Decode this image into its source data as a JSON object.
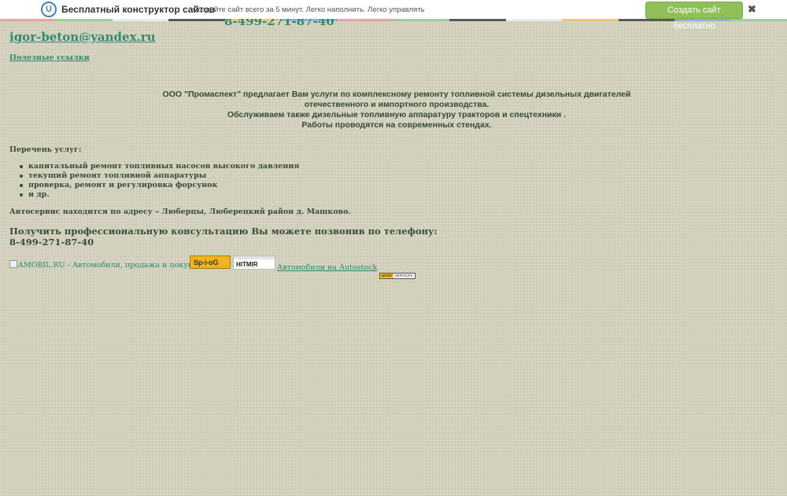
{
  "promo_bar": {
    "logo_letter": "U",
    "title": "Бесплатный конструктор сайтов",
    "subtitle": "Создайте сайт всего за 5 минут. Легко наполнить. Легко управлять",
    "cta_label": "Создать сайт бесплатно",
    "close_glyph": "✖",
    "stripe_colors": [
      "#e8a3a3",
      "#9ccf9c",
      "#ececec",
      "#5a5a5a",
      "#f0c27a",
      "#8db0d6",
      "#e8a3a3",
      "#9ccf9c",
      "#5a5a5a",
      "#ececec",
      "#f0c27a",
      "#5a5a5a",
      "#8db0d6",
      "#9ccf9c"
    ]
  },
  "header": {
    "phone_partial": "8-499-271-87-40",
    "email": "igor-beton@yandex.ru",
    "useful_links": "Полезные ссылки"
  },
  "intro": {
    "line1": "ООО \"Промаспект\" предлагает Вам услуги по комплексному ремонту топливной системы дизельных двигателей",
    "line2": "отечественного и импортного производства.",
    "line3": "Обслуживаем также дизельные топливную аппаратуру тракторов и спецтехники .",
    "line4": "Работы проводятся на современных стендах."
  },
  "services": {
    "title": "Перечень услуг:",
    "items": [
      "капитальный ремонт топливных насосов высокого давления",
      "текущий ремонт топливной аппаратуры",
      "проверка, ремонт и регулировка форсунок",
      "и др."
    ]
  },
  "address": "Автосервис находится по адресу – Люберцы, Люберецкий район д. Машково.",
  "consult": {
    "text": "Получить профессиональную консультацию Вы можете позвонив по телефону:",
    "phone": "8-499-271-87-40"
  },
  "banners": {
    "amobil_alt": "AMOBIL.RU - Автомобили, продажа и покупка авто",
    "spylog": "Sp⊹oG",
    "hitmir": "HITMIR",
    "autostock": "Автомобили на Autostock",
    "ucoz_left": "UCOZ",
    "ucoz_right": "SERVICES"
  },
  "colors": {
    "background": "#cfcfb9",
    "link": "#2f8a6e",
    "text": "#3b4a3a",
    "cta_green": "#8fbf56"
  }
}
